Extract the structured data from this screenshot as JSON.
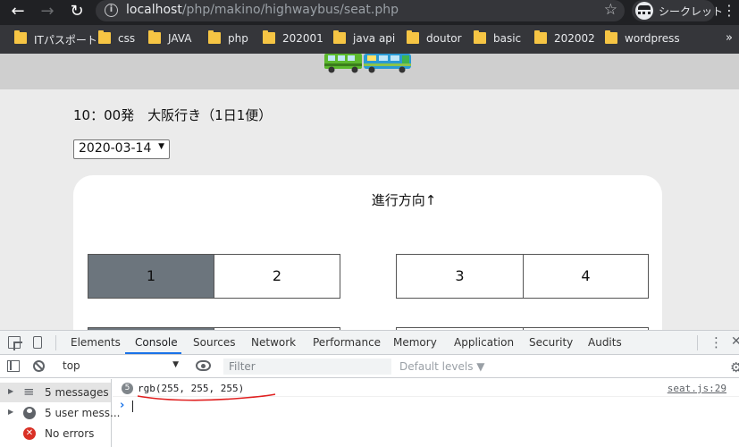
{
  "browser": {
    "url_host": "localhost",
    "url_path": "/php/makino/highwaybus/seat.php",
    "incognito_label": "シークレット",
    "bookmarks": [
      "ITパスポート",
      "css",
      "JAVA",
      "php",
      "202001",
      "java api",
      "doutor",
      "basic",
      "202002",
      "wordpress"
    ]
  },
  "page": {
    "trip_title": "10：00発　大阪行き（1日1便）",
    "selected_date": "2020-03-14",
    "direction_label": "進行方向↑",
    "seats": [
      "1",
      "2",
      "3",
      "4"
    ],
    "selected_seat": "1",
    "colors": {
      "selected_seat": "#6c757d",
      "page_bg": "#ebebeb",
      "header_band": "#cfcfcf"
    }
  },
  "devtools": {
    "tabs": [
      "Elements",
      "Console",
      "Sources",
      "Network",
      "Performance",
      "Memory",
      "Application",
      "Security",
      "Audits"
    ],
    "active_tab": "Console",
    "context": "top",
    "filter_placeholder": "Filter",
    "levels_label": "Default levels ▼",
    "sidebar": [
      {
        "label": "5 messages",
        "icon": "list-icon"
      },
      {
        "label": "5 user mess...",
        "icon": "user-icon"
      },
      {
        "label": "No errors",
        "icon": "error-icon"
      }
    ],
    "log": {
      "count": "5",
      "text": "rgb(255, 255, 255)",
      "source": "seat.js:29"
    }
  }
}
